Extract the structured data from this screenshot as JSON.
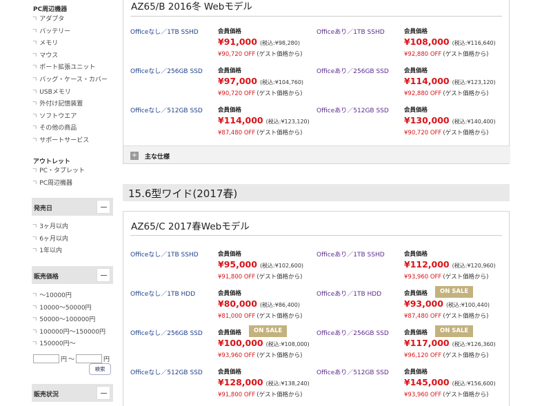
{
  "sidebar": {
    "peripherals_heading": "PC周辺機器",
    "peripherals": [
      "アダプタ",
      "バッテリー",
      "メモリ",
      "マウス",
      "ポート拡張ユニット",
      "バッグ・ケース・カバー",
      "USBメモリ",
      "外付け記憶装置",
      "ソフトウエア",
      "その他の商品",
      "サポートサービス"
    ],
    "outlet_heading": "アウトレット",
    "outlet": [
      "PC・タブレット",
      "PC周辺機器"
    ],
    "release_heading": "発売日",
    "release": [
      "3ヶ月以内",
      "6ヶ月以内",
      "1年以内"
    ],
    "price_heading": "販売価格",
    "prices": [
      "～10000円",
      "10000～50000円",
      "50000～100000円",
      "100000円～150000円",
      "150000円～"
    ],
    "yen_label": "円",
    "range_sep": "～",
    "search_button": "検索",
    "status_heading": "販売状況",
    "angle_glyph": "ㄱ"
  },
  "main": {
    "member_label": "会員価格",
    "onsale_label": "ON SALE",
    "guest_note": "(ゲスト価格から)",
    "spec_label": "主な仕様",
    "section_title": "15.6型ワイド(2017春)",
    "models": [
      {
        "title": "AZ65/B 2016冬 Webモデル",
        "rows": [
          {
            "left": {
              "name": "Officeなし／1TB SSHD",
              "price": "¥91,000",
              "tax": "(税込:¥98,280)",
              "guest": "¥90,720 OFF",
              "sale": false
            },
            "right": {
              "name": "Officeあり／1TB SSHD",
              "price": "¥108,000",
              "tax": "(税込:¥116,640)",
              "guest": "¥92,880 OFF",
              "sale": false
            }
          },
          {
            "left": {
              "name": "Officeなし／256GB SSD",
              "price": "¥97,000",
              "tax": "(税込:¥104,760)",
              "guest": "¥90,720 OFF",
              "sale": false
            },
            "right": {
              "name": "Officeあり／256GB SSD",
              "price": "¥114,000",
              "tax": "(税込:¥123,120)",
              "guest": "¥92,880 OFF",
              "sale": false
            }
          },
          {
            "left": {
              "name": "Officeなし／512GB SSD",
              "price": "¥114,000",
              "tax": "(税込:¥123,120)",
              "guest": "¥87,480 OFF",
              "sale": false
            },
            "right": {
              "name": "Officeあり／512GB SSD",
              "price": "¥130,000",
              "tax": "(税込:¥140,400)",
              "guest": "¥90,720 OFF",
              "sale": false
            }
          }
        ]
      },
      {
        "title": "AZ65/C 2017春Webモデル",
        "rows": [
          {
            "left": {
              "name": "Officeなし／1TB SSHD",
              "price": "¥95,000",
              "tax": "(税込:¥102,600)",
              "guest": "¥91,800 OFF",
              "sale": false
            },
            "right": {
              "name": "Officeあり／1TB SSHD",
              "price": "¥112,000",
              "tax": "(税込:¥120,960)",
              "guest": "¥93,960 OFF",
              "sale": false
            }
          },
          {
            "left": {
              "name": "Officeなし／1TB HDD",
              "price": "¥80,000",
              "tax": "(税込:¥86,400)",
              "guest": "¥81,000 OFF",
              "sale": false
            },
            "right": {
              "name": "Officeあり／1TB HDD",
              "price": "¥93,000",
              "tax": "(税込:¥100,440)",
              "guest": "¥87,480 OFF",
              "sale": true
            }
          },
          {
            "left": {
              "name": "Officeなし／256GB SSD",
              "price": "¥100,000",
              "tax": "(税込:¥108,000)",
              "guest": "¥93,960 OFF",
              "sale": true
            },
            "right": {
              "name": "Officeあり／256GB SSD",
              "price": "¥117,000",
              "tax": "(税込:¥126,360)",
              "guest": "¥96,120 OFF",
              "sale": true
            }
          },
          {
            "left": {
              "name": "Officeなし／512GB SSD",
              "price": "¥128,000",
              "tax": "(税込:¥138,240)",
              "guest": "¥91,800 OFF",
              "sale": false
            },
            "right": {
              "name": "Officeあり／512GB SSD",
              "price": "¥145,000",
              "tax": "(税込:¥156,600)",
              "guest": "¥93,960 OFF",
              "sale": false
            }
          }
        ]
      }
    ]
  }
}
